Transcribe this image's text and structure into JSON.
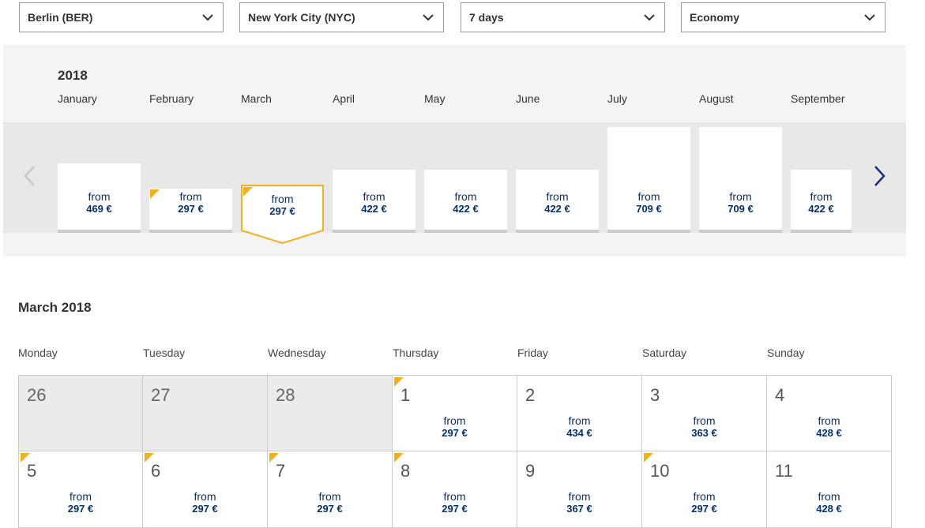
{
  "filters": {
    "origin": "Berlin (BER)",
    "destination": "New York City (NYC)",
    "duration": "7 days",
    "cabin": "Economy"
  },
  "strip": {
    "year": "2018",
    "months": [
      {
        "name": "January",
        "from": "from",
        "price": "469 €",
        "level": 0.63,
        "flag": false,
        "selected": false
      },
      {
        "name": "February",
        "from": "from",
        "price": "297 €",
        "level": 0.4,
        "flag": true,
        "selected": false
      },
      {
        "name": "March",
        "from": "from",
        "price": "297 €",
        "level": 0.4,
        "flag": true,
        "selected": true
      },
      {
        "name": "April",
        "from": "from",
        "price": "422 €",
        "level": 0.57,
        "flag": false,
        "selected": false
      },
      {
        "name": "May",
        "from": "from",
        "price": "422 €",
        "level": 0.57,
        "flag": false,
        "selected": false
      },
      {
        "name": "June",
        "from": "from",
        "price": "422 €",
        "level": 0.57,
        "flag": false,
        "selected": false
      },
      {
        "name": "July",
        "from": "from",
        "price": "709 €",
        "level": 0.96,
        "flag": false,
        "selected": false
      },
      {
        "name": "August",
        "from": "from",
        "price": "709 €",
        "level": 0.96,
        "flag": false,
        "selected": false
      },
      {
        "name": "September",
        "from": "from",
        "price": "422 €",
        "level": 0.57,
        "flag": false,
        "selected": false
      }
    ]
  },
  "calendar": {
    "title": "March 2018",
    "weekdays": [
      "Monday",
      "Tuesday",
      "Wednesday",
      "Thursday",
      "Friday",
      "Saturday",
      "Sunday"
    ],
    "rows": [
      [
        {
          "day": "26",
          "off": true
        },
        {
          "day": "27",
          "off": true
        },
        {
          "day": "28",
          "off": true
        },
        {
          "day": "1",
          "from": "from",
          "price": "297 €",
          "flag": true
        },
        {
          "day": "2",
          "from": "from",
          "price": "434 €",
          "flag": false
        },
        {
          "day": "3",
          "from": "from",
          "price": "363 €",
          "flag": false
        },
        {
          "day": "4",
          "from": "from",
          "price": "428 €",
          "flag": false
        }
      ],
      [
        {
          "day": "5",
          "from": "from",
          "price": "297 €",
          "flag": true
        },
        {
          "day": "6",
          "from": "from",
          "price": "297 €",
          "flag": true
        },
        {
          "day": "7",
          "from": "from",
          "price": "297 €",
          "flag": true
        },
        {
          "day": "8",
          "from": "from",
          "price": "297 €",
          "flag": true
        },
        {
          "day": "9",
          "from": "from",
          "price": "367 €",
          "flag": false
        },
        {
          "day": "10",
          "from": "from",
          "price": "297 €",
          "flag": true
        },
        {
          "day": "11",
          "from": "from",
          "price": "428 €",
          "flag": false
        }
      ]
    ]
  },
  "colors": {
    "accent": "#f2b01e",
    "price": "#06306e",
    "arrow_active": "#1d2c7a",
    "arrow_inactive": "#c8c8c8"
  }
}
